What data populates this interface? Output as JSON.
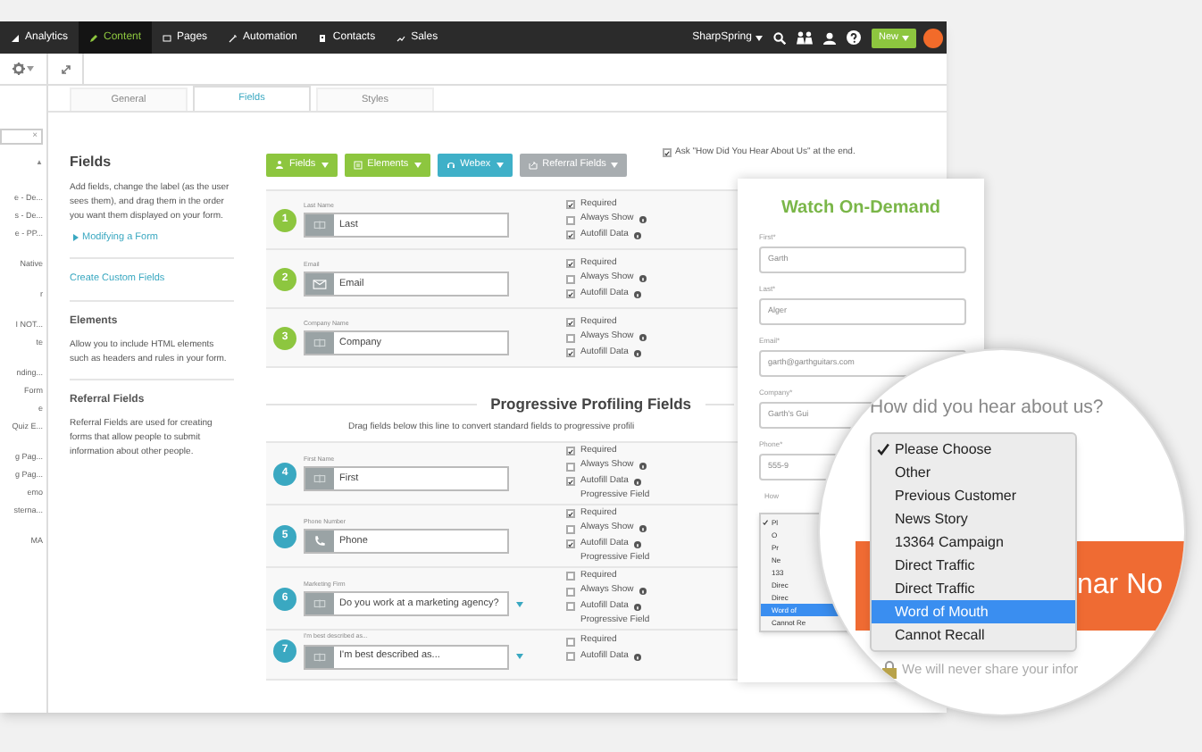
{
  "nav": {
    "items": [
      {
        "label": "Analytics",
        "selected": false
      },
      {
        "label": "Content",
        "selected": true
      },
      {
        "label": "Pages",
        "selected": false
      },
      {
        "label": "Automation",
        "selected": false
      },
      {
        "label": "Contacts",
        "selected": false
      },
      {
        "label": "Sales",
        "selected": false
      }
    ],
    "account": "SharpSpring",
    "new_button": "New"
  },
  "sidebar": {
    "clear": "×",
    "collapse": "▲",
    "groups": [
      [
        "e - De...",
        "s - De...",
        "e - PP..."
      ],
      [
        "Native"
      ],
      [
        "r"
      ],
      [
        "I NOT...",
        "te"
      ],
      [
        "nding...",
        "Form",
        "e",
        "Quiz E..."
      ],
      [
        "g Pag...",
        "g Pag...",
        "emo",
        "sterna..."
      ],
      [
        "MA"
      ]
    ]
  },
  "tabs": [
    {
      "label": "General",
      "selected": false
    },
    {
      "label": "Fields",
      "selected": true
    },
    {
      "label": "Styles",
      "selected": false
    }
  ],
  "info": {
    "sections": [
      {
        "title": "Fields",
        "text": "Add fields, change the label (as the user sees them), and drag them in the order you want them displayed on your form.",
        "link": "Modifying a Form"
      },
      {
        "link": "Create Custom Fields"
      },
      {
        "title": "Elements",
        "text": "Allow you to include HTML elements such as headers and rules in your form."
      },
      {
        "title": "Referral Fields",
        "text": "Referral Fields are used for creating forms that allow people to submit information about other people."
      }
    ]
  },
  "buttons": [
    {
      "label": "Fields",
      "color": "#8dc63f"
    },
    {
      "label": "Elements",
      "color": "#8dc63f"
    },
    {
      "label": "Webex",
      "color": "#3fb0c8"
    },
    {
      "label": "Referral Fields",
      "color": "#a8adb0"
    }
  ],
  "ask_option": {
    "label": "Ask \"How Did You Hear About Us\" at the end.",
    "checked": true
  },
  "rows": [
    {
      "number": "1",
      "color": "#8dc63f",
      "label": "Last Name",
      "kind": "text",
      "value": "Last",
      "dropdown": false,
      "options": [
        {
          "label": "Required",
          "checked": true,
          "info": false
        },
        {
          "label": "Always Show",
          "checked": false,
          "info": true
        },
        {
          "label": "Autofill Data",
          "checked": true,
          "info": true
        }
      ]
    },
    {
      "number": "2",
      "color": "#8dc63f",
      "label": "Email",
      "kind": "email",
      "value": "Email",
      "dropdown": false,
      "options": [
        {
          "label": "Required",
          "checked": true,
          "info": false
        },
        {
          "label": "Always Show",
          "checked": false,
          "info": true
        },
        {
          "label": "Autofill Data",
          "checked": true,
          "info": true
        }
      ]
    },
    {
      "number": "3",
      "color": "#8dc63f",
      "label": "Company Name",
      "kind": "text",
      "value": "Company",
      "dropdown": false,
      "options": [
        {
          "label": "Required",
          "checked": true,
          "info": false
        },
        {
          "label": "Always Show",
          "checked": false,
          "info": true
        },
        {
          "label": "Autofill Data",
          "checked": true,
          "info": true
        }
      ]
    }
  ],
  "progressive": {
    "title": "Progressive Profiling Fields",
    "hint": "Drag fields below this line to convert standard fields to progressive profili",
    "rows": [
      {
        "number": "4",
        "color": "#3aa8c1",
        "label": "First Name",
        "kind": "text",
        "value": "First",
        "dropdown": false,
        "note": "Progressive Field",
        "options": [
          {
            "label": "Required",
            "checked": true,
            "info": false
          },
          {
            "label": "Always Show",
            "checked": false,
            "info": true
          },
          {
            "label": "Autofill Data",
            "checked": true,
            "info": true
          }
        ]
      },
      {
        "number": "5",
        "color": "#3aa8c1",
        "label": "Phone Number",
        "kind": "phone",
        "value": "Phone",
        "dropdown": false,
        "note": "Progressive Field",
        "options": [
          {
            "label": "Required",
            "checked": true,
            "info": false
          },
          {
            "label": "Always Show",
            "checked": false,
            "info": true
          },
          {
            "label": "Autofill Data",
            "checked": true,
            "info": true
          }
        ]
      },
      {
        "number": "6",
        "color": "#3aa8c1",
        "label": "Marketing Firm",
        "kind": "text",
        "value": "Do you work at a marketing agency?",
        "dropdown": true,
        "note": "Progressive Field",
        "options": [
          {
            "label": "Required",
            "checked": false,
            "info": false
          },
          {
            "label": "Always Show",
            "checked": false,
            "info": true
          },
          {
            "label": "Autofill Data",
            "checked": false,
            "info": true
          }
        ]
      },
      {
        "number": "7",
        "color": "#3aa8c1",
        "label": "I'm best described as...",
        "kind": "text",
        "value": "I'm best described as...",
        "dropdown": true,
        "options": [
          {
            "label": "Required",
            "checked": false,
            "info": false
          },
          {
            "label": "Autofill Data",
            "checked": false,
            "info": true
          }
        ]
      }
    ]
  },
  "preview": {
    "title": "Watch On-Demand",
    "fields": [
      {
        "label": "First*",
        "value": "Garth"
      },
      {
        "label": "Last*",
        "value": "Alger"
      },
      {
        "label": "Email*",
        "value": "garth@garthguitars.com"
      },
      {
        "label": "Company*",
        "value": "Garth's Gui"
      },
      {
        "label": "Phone*",
        "value": "555-9"
      }
    ],
    "question_label": "How",
    "mini_options": [
      {
        "label": "Pl",
        "selected": false,
        "checked": true
      },
      {
        "label": "O",
        "selected": false,
        "checked": false
      },
      {
        "label": "Pr",
        "selected": false,
        "checked": false
      },
      {
        "label": "Ne",
        "selected": false,
        "checked": false
      },
      {
        "label": "133",
        "selected": false,
        "checked": false
      },
      {
        "label": "Direc",
        "selected": false,
        "checked": false
      },
      {
        "label": "Direc",
        "selected": false,
        "checked": false
      },
      {
        "label": "Word of",
        "selected": true,
        "checked": false
      },
      {
        "label": "Cannot Re",
        "selected": false,
        "checked": false
      }
    ]
  },
  "magnifier": {
    "question": "How did you hear about us?",
    "options": [
      {
        "label": "Please Choose",
        "selected": false,
        "checked": true
      },
      {
        "label": "Other",
        "selected": false,
        "checked": false
      },
      {
        "label": "Previous Customer",
        "selected": false,
        "checked": false
      },
      {
        "label": "News Story",
        "selected": false,
        "checked": false
      },
      {
        "label": "13364 Campaign",
        "selected": false,
        "checked": false
      },
      {
        "label": "Direct Traffic",
        "selected": false,
        "checked": false
      },
      {
        "label": "Direct Traffic",
        "selected": false,
        "checked": false
      },
      {
        "label": "Word of Mouth",
        "selected": true,
        "checked": false
      },
      {
        "label": "Cannot Recall",
        "selected": false,
        "checked": false
      }
    ],
    "button": "nar No",
    "privacy": "We will never share your infor"
  }
}
